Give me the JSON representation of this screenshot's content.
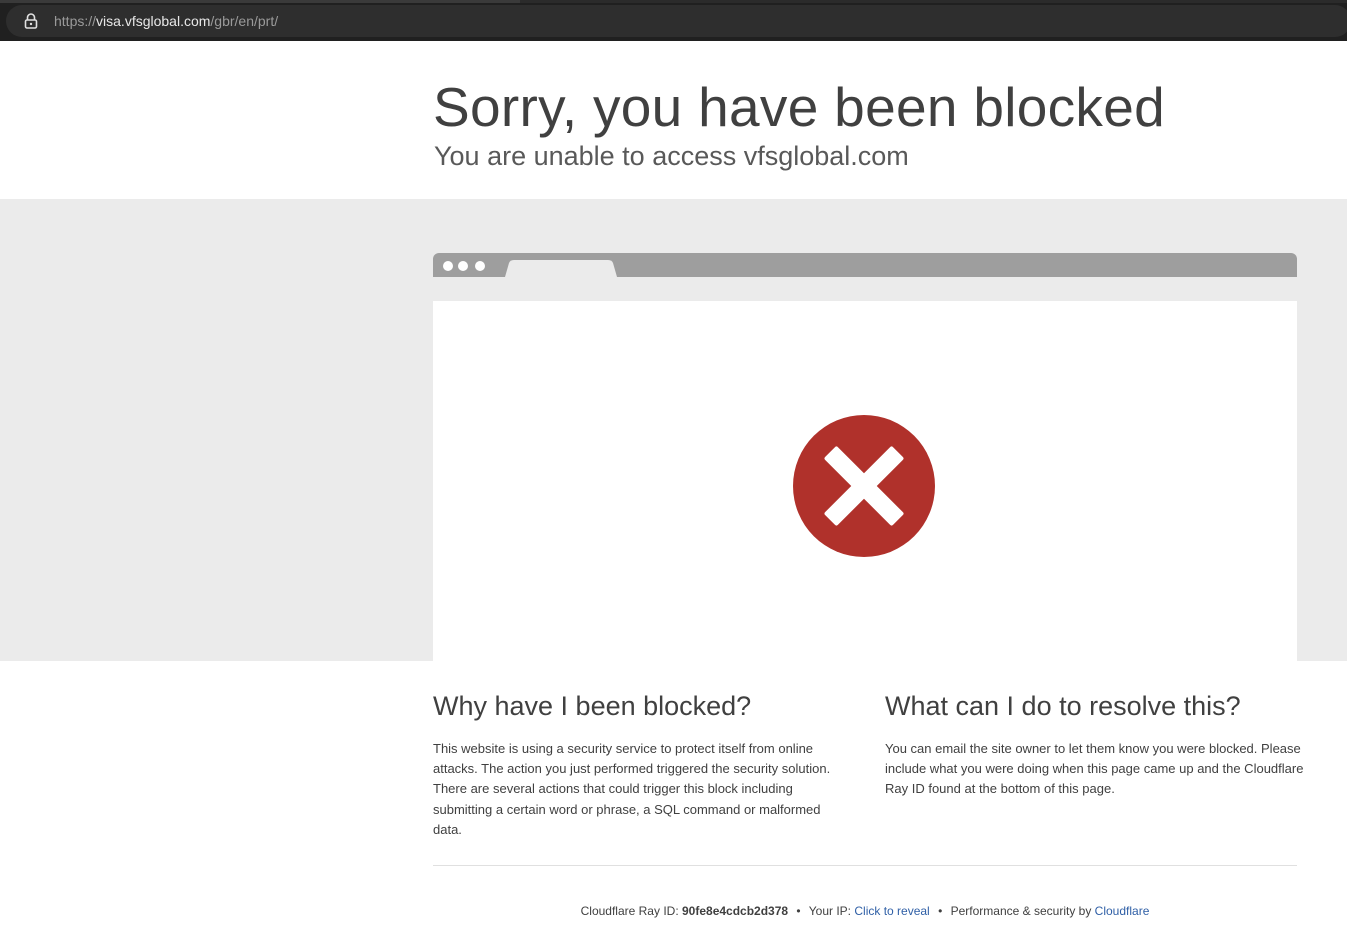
{
  "browser": {
    "url_scheme": "https://",
    "url_host": "visa.vfsglobal.com",
    "url_path": "/gbr/en/prt/"
  },
  "header": {
    "title": "Sorry, you have been blocked",
    "subtitle": "You are unable to access vfsglobal.com"
  },
  "illustration": {
    "icon": "error-x-icon",
    "icon_color": "#b0312b"
  },
  "why": {
    "heading": "Why have I been blocked?",
    "body": "This website is using a security service to protect itself from online attacks. The action you just performed triggered the security solution. There are several actions that could trigger this block including submitting a certain word or phrase, a SQL command or malformed data."
  },
  "resolve": {
    "heading": "What can I do to resolve this?",
    "body": "You can email the site owner to let them know you were blocked. Please include what you were doing when this page came up and the Cloudflare Ray ID found at the bottom of this page."
  },
  "footer": {
    "ray_label": "Cloudflare Ray ID:",
    "ray_id": "90fe8e4cdcb2d378",
    "separator": "•",
    "ip_label": "Your IP:",
    "ip_link": "Click to reveal",
    "perf_label": "Performance & security by",
    "perf_link": "Cloudflare",
    "link_color": "#2f5fa6"
  }
}
